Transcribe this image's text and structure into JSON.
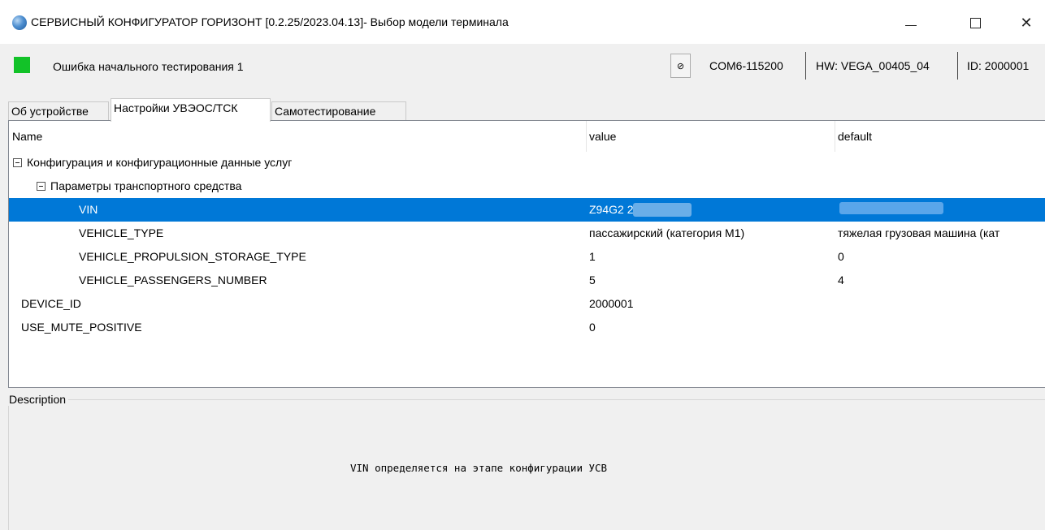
{
  "window": {
    "title": "СЕРВИСНЫЙ КОНФИГУРАТОР ГОРИЗОНТ [0.2.25/2023.04.13]- Выбор модели терминала",
    "minimize_glyph": "",
    "maximize_glyph": "",
    "close_glyph": "✕"
  },
  "status": {
    "message": "Ошибка начального тестирования 1",
    "led_color": "#12c228",
    "port_button_glyph": "⊘",
    "port": "COM6-115200",
    "hw": "HW:  VEGA_00405_04",
    "id": "ID:  2000001"
  },
  "tabs": [
    {
      "label": "Об устройстве",
      "active": false
    },
    {
      "label": "Настройки УВЭОС/ТСК",
      "active": true
    },
    {
      "label": "Самотестирование",
      "active": false
    }
  ],
  "grid": {
    "columns": {
      "name": "Name",
      "value": "value",
      "default": "default"
    },
    "rows": [
      {
        "name": "Конфигурация и конфигурационные данные услуг",
        "value": "",
        "default": ""
      },
      {
        "name": "Параметры транспортного средства",
        "value": "",
        "default": ""
      },
      {
        "name": "VIN",
        "value": "Z94G2          269907",
        "default": ""
      },
      {
        "name": "VEHICLE_TYPE",
        "value": "пассажирский (категория М1)",
        "default": "тяжелая грузовая машина (кат"
      },
      {
        "name": "VEHICLE_PROPULSION_STORAGE_TYPE",
        "value": "1",
        "default": "0"
      },
      {
        "name": "VEHICLE_PASSENGERS_NUMBER",
        "value": "5",
        "default": "4"
      },
      {
        "name": "DEVICE_ID",
        "value": "2000001",
        "default": ""
      },
      {
        "name": "USE_MUTE_POSITIVE",
        "value": "0",
        "default": ""
      }
    ],
    "selected_color": "#0078d7"
  },
  "description": {
    "label": "Description",
    "text": "VIN определяется на этапе конфигурации УСВ"
  }
}
